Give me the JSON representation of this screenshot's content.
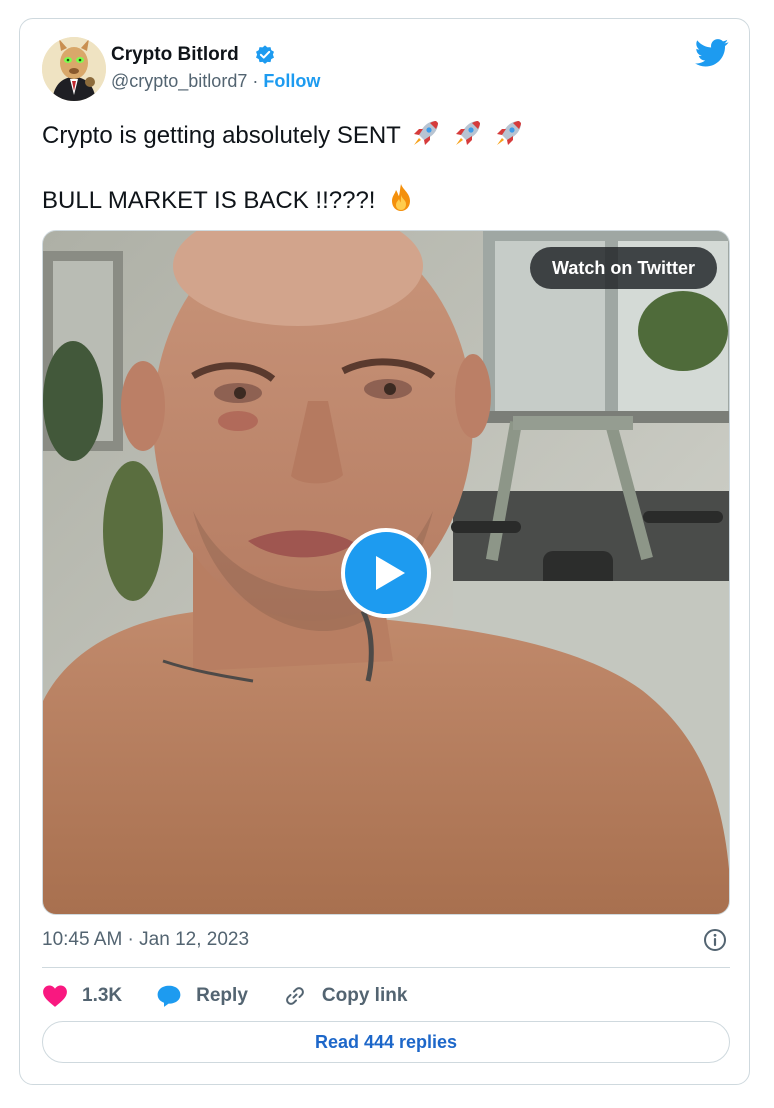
{
  "author": {
    "name": "Crypto Bitlord",
    "handle": "@crypto_bitlord7",
    "separator": "·",
    "follow_label": "Follow"
  },
  "tweet": {
    "line1": "Crypto is getting absolutely SENT",
    "line1_emojis": [
      "rocket-emoji",
      "rocket-emoji",
      "rocket-emoji"
    ],
    "line2": "BULL MARKET IS BACK !!???!",
    "line2_emoji": "fire-emoji"
  },
  "media": {
    "watch_label": "Watch on Twitter",
    "play_icon": "play-icon"
  },
  "meta": {
    "timestamp": "10:45 AM · Jan 12, 2023"
  },
  "actions": {
    "like_count": "1.3K",
    "reply_label": "Reply",
    "copy_label": "Copy link"
  },
  "footer": {
    "read_replies_label": "Read 444 replies"
  },
  "colors": {
    "accent": "#1d9bf0",
    "like": "#f91880",
    "text": "#0f1419",
    "muted": "#536471",
    "border": "#cfd9de"
  }
}
